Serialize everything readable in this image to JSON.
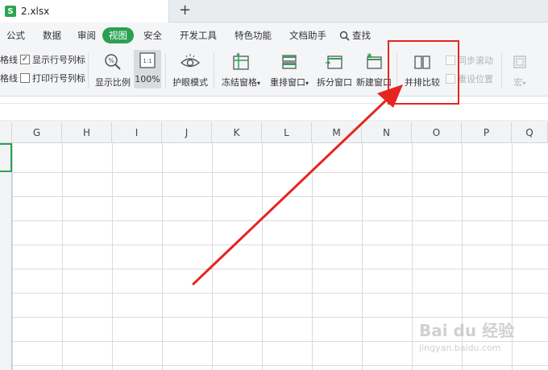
{
  "tabbar": {
    "file_name": "2.xlsx",
    "logo_letter": "S",
    "new_tab": "+"
  },
  "menubar": {
    "items": [
      "公式",
      "数据",
      "审阅",
      "视图",
      "安全",
      "开发工具",
      "特色功能",
      "文档助手"
    ],
    "active": "视图",
    "search_label": "查找"
  },
  "ribbon": {
    "checks": [
      {
        "prefix": "格线",
        "label": "显示行号列标",
        "checked": true
      },
      {
        "prefix": "格线",
        "label": "打印行号列标",
        "checked": false
      }
    ],
    "buttons": {
      "zoom": "显示比例",
      "zoom100": "100%",
      "zoom100_icon_text": "1:1",
      "eye_mode": "护眼模式",
      "freeze": "冻结窗格",
      "rearrange": "重排窗口",
      "split": "拆分窗口",
      "new_window": "新建窗口",
      "side_by_side": "并排比较",
      "sync_scroll": "同步滚动",
      "reset_position": "重设位置",
      "macro": "宏"
    },
    "dropdown_glyph": "▾"
  },
  "columns": [
    "G",
    "H",
    "I",
    "J",
    "K",
    "L",
    "M",
    "N",
    "O",
    "P",
    "Q"
  ],
  "watermark": {
    "brand": "Bai du 经验",
    "url": "jingyan.baidu.com"
  },
  "colors": {
    "accent": "#2aa152",
    "annotation": "#e52520"
  }
}
